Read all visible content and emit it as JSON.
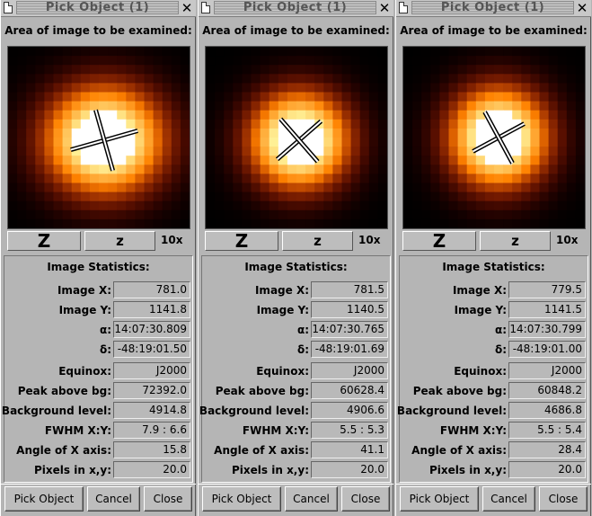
{
  "panels": [
    {
      "title": "Pick Object (1)",
      "area_label": "Area of image to be examined:",
      "zoom_big": "Z",
      "zoom_small": "z",
      "zoom_level": "10x",
      "stats_title": "Image Statistics:",
      "stats": [
        {
          "label": "Image X:",
          "value": "781.0"
        },
        {
          "label": "Image Y:",
          "value": "1141.8"
        },
        {
          "label": "α:",
          "value": "14:07:30.809"
        },
        {
          "label": "δ:",
          "value": "-48:19:01.50"
        },
        {
          "label": "Equinox:",
          "value": "J2000"
        },
        {
          "label": "Peak above bg:",
          "value": "72392.0"
        },
        {
          "label": "Background level:",
          "value": "4914.8"
        },
        {
          "label": "FWHM X:Y:",
          "value": "7.9 : 6.6"
        },
        {
          "label": "Angle of X axis:",
          "value": "15.8"
        },
        {
          "label": "Pixels in x,y:",
          "value": "20.0"
        }
      ],
      "buttons": {
        "pick": "Pick Object",
        "cancel": "Cancel",
        "close": "Close"
      }
    },
    {
      "title": "Pick Object (1)",
      "area_label": "Area of image to be examined:",
      "zoom_big": "Z",
      "zoom_small": "z",
      "zoom_level": "10x",
      "stats_title": "Image Statistics:",
      "stats": [
        {
          "label": "Image X:",
          "value": "781.5"
        },
        {
          "label": "Image Y:",
          "value": "1140.5"
        },
        {
          "label": "α:",
          "value": "14:07:30.765"
        },
        {
          "label": "δ:",
          "value": "-48:19:01.69"
        },
        {
          "label": "Equinox:",
          "value": "J2000"
        },
        {
          "label": "Peak above bg:",
          "value": "60628.4"
        },
        {
          "label": "Background level:",
          "value": "4906.6"
        },
        {
          "label": "FWHM X:Y:",
          "value": "5.5 : 5.3"
        },
        {
          "label": "Angle of X axis:",
          "value": "41.1"
        },
        {
          "label": "Pixels in x,y:",
          "value": "20.0"
        }
      ],
      "buttons": {
        "pick": "Pick Object",
        "cancel": "Cancel",
        "close": "Close"
      }
    },
    {
      "title": "Pick Object (1)",
      "area_label": "Area of image to be examined:",
      "zoom_big": "Z",
      "zoom_small": "z",
      "zoom_level": "10x",
      "stats_title": "Image Statistics:",
      "stats": [
        {
          "label": "Image X:",
          "value": "779.5"
        },
        {
          "label": "Image Y:",
          "value": "1141.5"
        },
        {
          "label": "α:",
          "value": "14:07:30.799"
        },
        {
          "label": "δ:",
          "value": "-48:19:01.00"
        },
        {
          "label": "Equinox:",
          "value": "J2000"
        },
        {
          "label": "Peak above bg:",
          "value": "60848.2"
        },
        {
          "label": "Background level:",
          "value": "4686.8"
        },
        {
          "label": "FWHM X:Y:",
          "value": "5.5 : 5.4"
        },
        {
          "label": "Angle of X axis:",
          "value": "28.4"
        },
        {
          "label": "Pixels in x,y:",
          "value": "20.0"
        }
      ],
      "buttons": {
        "pick": "Pick Object",
        "cancel": "Cancel",
        "close": "Close"
      }
    }
  ],
  "colors": {
    "window_bg": "#b5b5b5",
    "star_core": "#ffffff",
    "star_mid": "#ff8a00",
    "star_edge": "#000000"
  }
}
